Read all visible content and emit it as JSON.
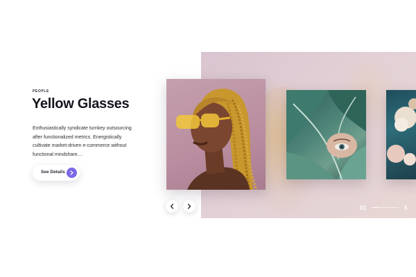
{
  "slide": {
    "category": "PEOPLE",
    "title": "Yellow Glasses",
    "description": "Enthusiastically syndicate turnkey outsourcing after functionalized metrics. Energistically cultivate market-driven e-commerce without functional mindshare....",
    "details_label": "See Details"
  },
  "pager": {
    "current": "01",
    "total": "5",
    "progress": 0.2
  },
  "icons": {
    "details": "chevron-right-icon",
    "prev": "chevron-left-icon",
    "next": "chevron-right-icon"
  },
  "colors": {
    "accent": "#7c68e6",
    "stage_bg": "#e0ccd3",
    "title": "#15151e"
  }
}
